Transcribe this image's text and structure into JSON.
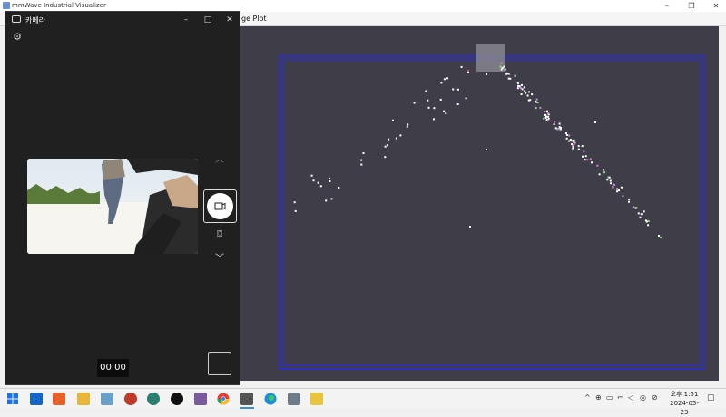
{
  "viz_window": {
    "title": "mmWave Industrial Visualizer",
    "tab_label": "ge Plot",
    "colors": {
      "plot_bg": "#3f3e48",
      "frame": "#2a2ae6"
    }
  },
  "camera": {
    "title": "카메라",
    "timer": "00:00",
    "icons": [
      "settings-icon",
      "chevron-up-icon",
      "video-icon",
      "camera-icon",
      "chevron-down-icon"
    ]
  },
  "taskbar": {
    "clock_period": "오후 1:51",
    "clock_date": "2024-05-23",
    "icons": [
      "start-icon",
      "outlook-icon",
      "app-icon",
      "folder-icon",
      "app-icon",
      "app-icon",
      "app-icon",
      "app-icon",
      "chrome-icon",
      "camera-icon",
      "edge-icon",
      "app-icon",
      "app-icon"
    ]
  }
}
